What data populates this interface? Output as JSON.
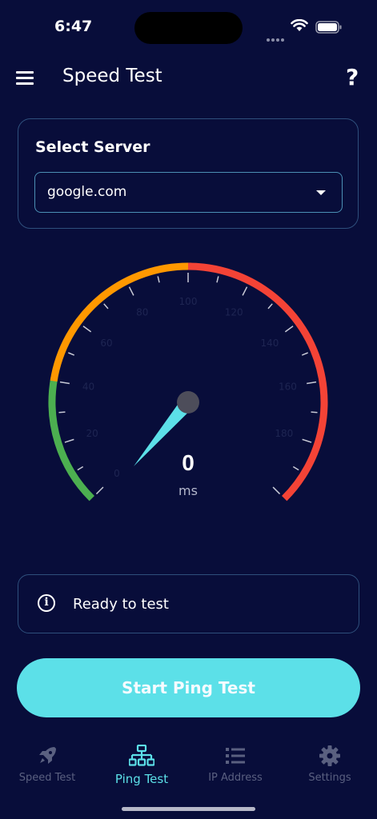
{
  "status_bar": {
    "time": "6:47"
  },
  "app_bar": {
    "title": "Speed Test",
    "help_label": "?"
  },
  "server": {
    "title": "Select Server",
    "selected": "google.com"
  },
  "gauge": {
    "value": "0",
    "unit": "ms",
    "min": 0,
    "max": 200,
    "ticks": [
      "0",
      "20",
      "40",
      "60",
      "80",
      "100",
      "120",
      "140",
      "160",
      "180"
    ],
    "colors": {
      "green": "#4caf50",
      "orange": "#ff9800",
      "red": "#f44336",
      "needle": "#5ce0e8"
    }
  },
  "status": {
    "text": "Ready to test",
    "icon": "info-icon"
  },
  "start_button": {
    "label": "Start Ping Test"
  },
  "nav": {
    "items": [
      {
        "label": "Speed Test",
        "icon": "rocket-icon"
      },
      {
        "label": "Ping Test",
        "icon": "network-icon",
        "active": true
      },
      {
        "label": "IP Address",
        "icon": "list-icon"
      },
      {
        "label": "Settings",
        "icon": "gear-icon"
      }
    ]
  },
  "theme": {
    "background": "#080d3a",
    "accent": "#5ce0e8",
    "border": "#2e4f7c"
  }
}
